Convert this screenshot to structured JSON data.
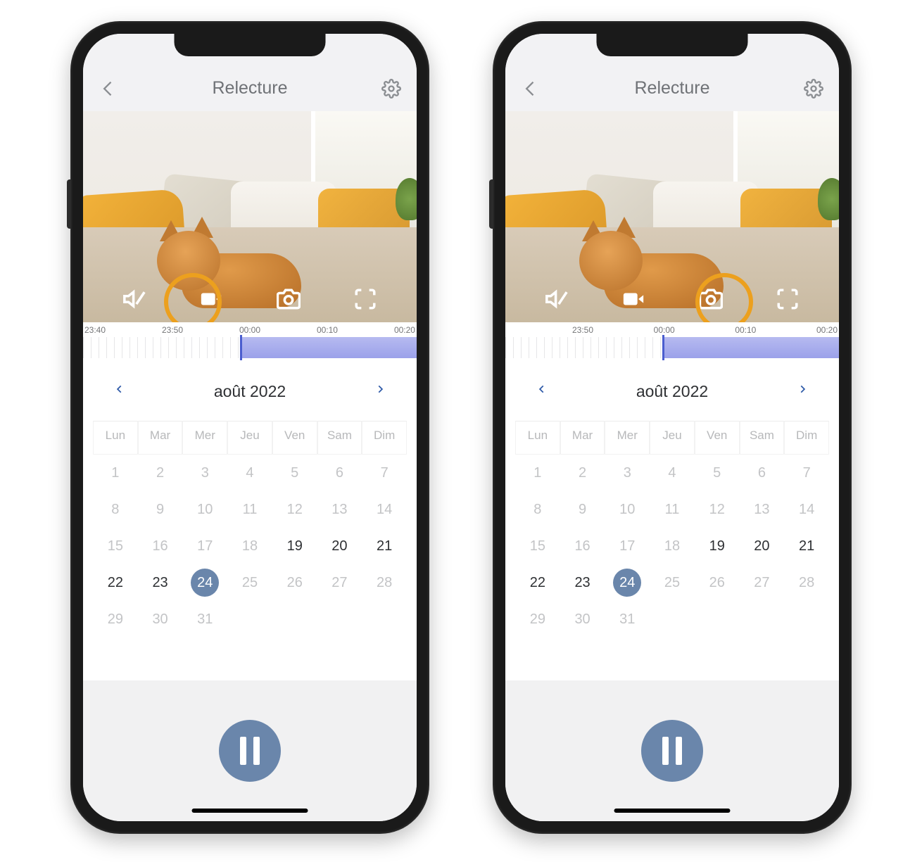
{
  "header": {
    "title": "Relecture"
  },
  "timeline": {
    "labels": [
      "23:40",
      "23:50",
      "00:00",
      "00:10",
      "00:20"
    ],
    "labels2": [
      "23:50",
      "00:00",
      "00:10",
      "00:20"
    ],
    "fill_start_pct": 47,
    "cursor_pct": 47
  },
  "calendar": {
    "month_label": "août 2022",
    "dow": [
      "Lun",
      "Mar",
      "Mer",
      "Jeu",
      "Ven",
      "Sam",
      "Dim"
    ],
    "days": [
      {
        "n": 1
      },
      {
        "n": 2
      },
      {
        "n": 3
      },
      {
        "n": 4
      },
      {
        "n": 5
      },
      {
        "n": 6
      },
      {
        "n": 7
      },
      {
        "n": 8
      },
      {
        "n": 9
      },
      {
        "n": 10
      },
      {
        "n": 11
      },
      {
        "n": 12
      },
      {
        "n": 13
      },
      {
        "n": 14
      },
      {
        "n": 15
      },
      {
        "n": 16
      },
      {
        "n": 17
      },
      {
        "n": 18
      },
      {
        "n": 19,
        "available": true
      },
      {
        "n": 20,
        "available": true
      },
      {
        "n": 21,
        "available": true
      },
      {
        "n": 22,
        "available": true
      },
      {
        "n": 23,
        "available": true
      },
      {
        "n": 24,
        "available": true,
        "selected": true
      },
      {
        "n": 25
      },
      {
        "n": 26
      },
      {
        "n": 27
      },
      {
        "n": 28
      },
      {
        "n": 29
      },
      {
        "n": 30
      },
      {
        "n": 31
      }
    ]
  },
  "video_controls": {
    "mute": "mute-icon",
    "record": "video-record-icon",
    "snapshot": "camera-icon",
    "fullscreen": "fullscreen-icon"
  },
  "phones": [
    {
      "highlight": "record"
    },
    {
      "highlight": "snapshot"
    }
  ]
}
